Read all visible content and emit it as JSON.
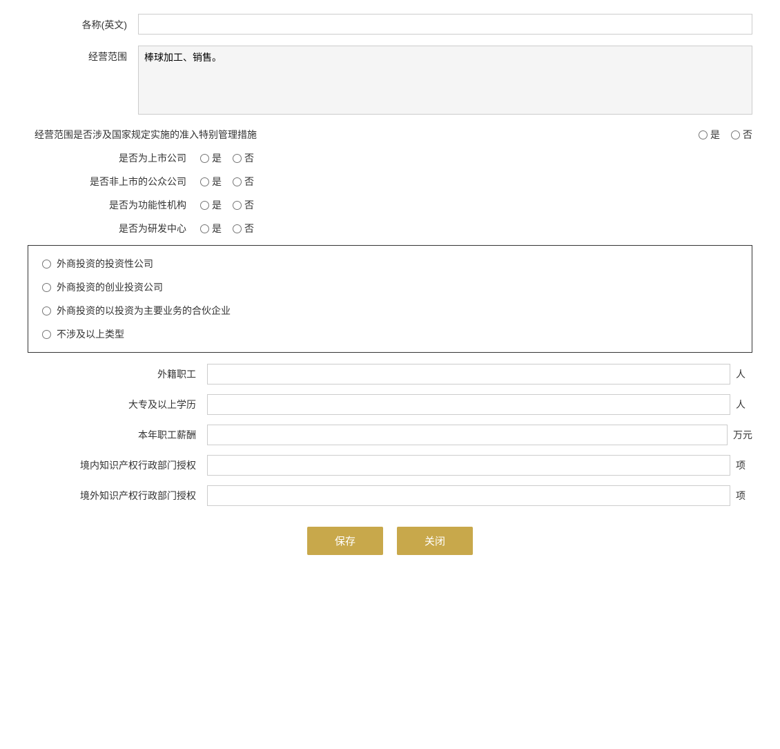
{
  "form": {
    "english_name_label": "各称(英文)",
    "business_scope_label": "经营范围",
    "business_scope_value": "棒球加工、销售。",
    "special_mgmt_label": "经营范围是否涉及国家规定实施的准入特别管理措施",
    "listed_company_label": "是否为上市公司",
    "public_company_label": "是否非上市的公众公司",
    "functional_org_label": "是否为功能性机构",
    "rd_center_label": "是否为研发中心",
    "yes_label": "是",
    "no_label": "否",
    "investment_options": [
      "外商投资的投资性公司",
      "外商投资的创业投资公司",
      "外商投资的以投资为主要业务的合伙企业",
      "不涉及以上类型"
    ],
    "foreign_employees_label": "外籍职工",
    "foreign_employees_unit": "人",
    "college_edu_label": "大专及以上学历",
    "college_edu_unit": "人",
    "annual_salary_label": "本年职工薪酬",
    "annual_salary_unit": "万元",
    "domestic_ip_label": "境内知识产权行政部门授权",
    "domestic_ip_unit": "项",
    "foreign_ip_label": "境外知识产权行政部门授权",
    "foreign_ip_unit": "项",
    "save_button": "保存",
    "close_button": "关闭"
  }
}
